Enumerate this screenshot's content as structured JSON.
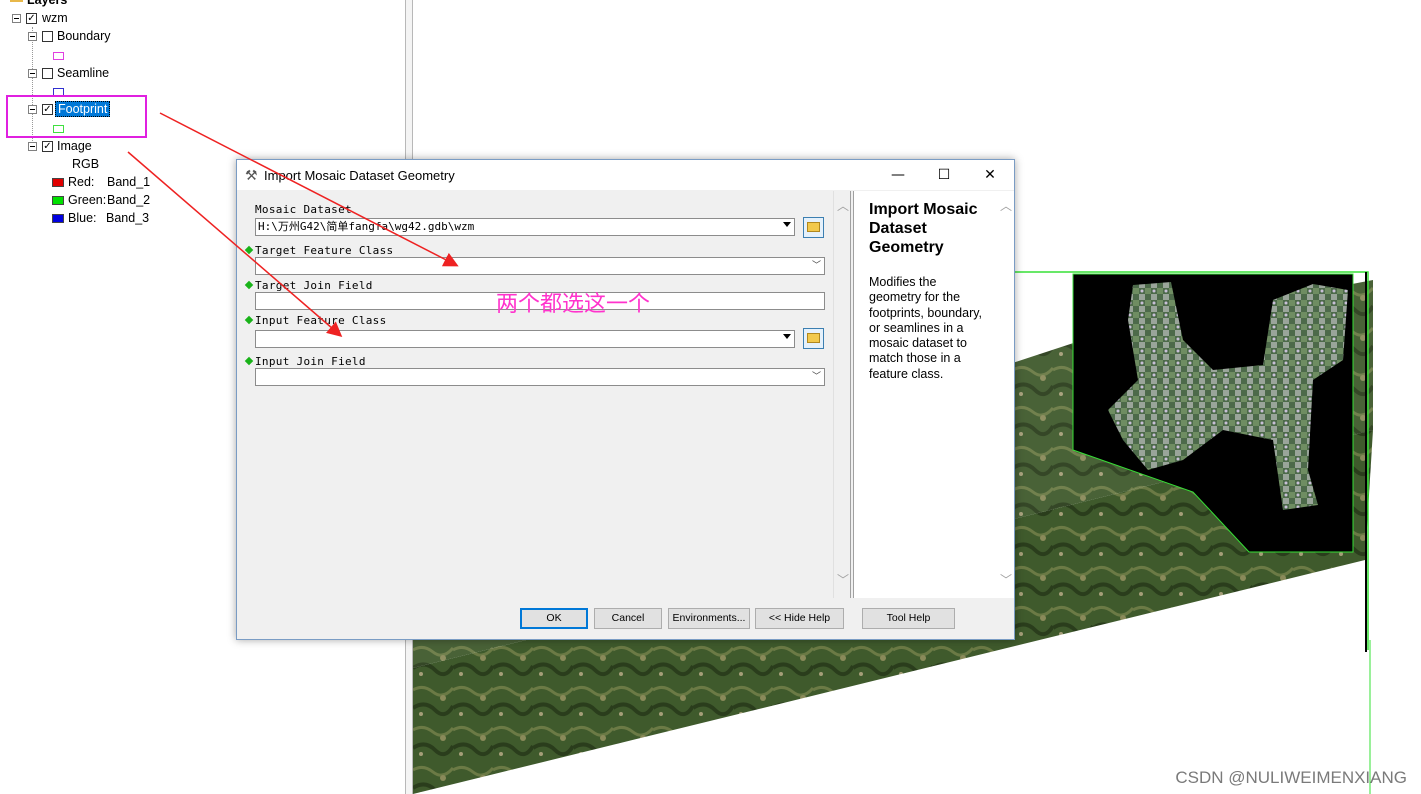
{
  "toc": {
    "header": "Layers",
    "group": {
      "name": "wzm",
      "checked": true
    },
    "layers": [
      {
        "name": "Boundary",
        "checked": false,
        "swatch_color": "#e040e0"
      },
      {
        "name": "Seamline",
        "checked": false,
        "swatch_color": "#3030d0"
      },
      {
        "name": "Footprint",
        "checked": true,
        "selected": true,
        "swatch_color": "#40e040"
      },
      {
        "name": "Image",
        "checked": true
      }
    ],
    "image_legend": {
      "title": "RGB",
      "bands": [
        {
          "channel": "Red:",
          "band": "Band_1",
          "color": "#e00000"
        },
        {
          "channel": "Green:",
          "band": "Band_2",
          "color": "#00e000"
        },
        {
          "channel": "Blue:",
          "band": "Band_3",
          "color": "#0000e0"
        }
      ]
    }
  },
  "dialog": {
    "title": "Import Mosaic Dataset Geometry",
    "window_buttons": {
      "minimize": "—",
      "maximize": "☐",
      "close": "✕"
    },
    "fields": {
      "mosaic_dataset": {
        "label": "Mosaic Dataset",
        "value": "H:\\万州G42\\简单fangfa\\wg42.gdb\\wzm"
      },
      "target_feature_class": {
        "label": "Target Feature Class",
        "value": ""
      },
      "target_join_field": {
        "label": "Target Join Field",
        "value": ""
      },
      "input_feature_class": {
        "label": "Input Feature Class",
        "value": ""
      },
      "input_join_field": {
        "label": "Input Join Field",
        "value": ""
      }
    },
    "help": {
      "title": "Import Mosaic Dataset Geometry",
      "body": "Modifies the geometry for the footprints, boundary, or seamlines in a mosaic dataset to match those in a feature class."
    },
    "buttons": {
      "ok": "OK",
      "cancel": "Cancel",
      "environments": "Environments...",
      "hide_help": "<< Hide Help",
      "tool_help": "Tool Help"
    }
  },
  "annotation": {
    "text": "两个都选这一个",
    "color": "#ff33cc",
    "highlight_color": "#e020e0",
    "arrow_color": "#ee2222"
  },
  "watermark": "CSDN @NULIWEIMENXIANG"
}
